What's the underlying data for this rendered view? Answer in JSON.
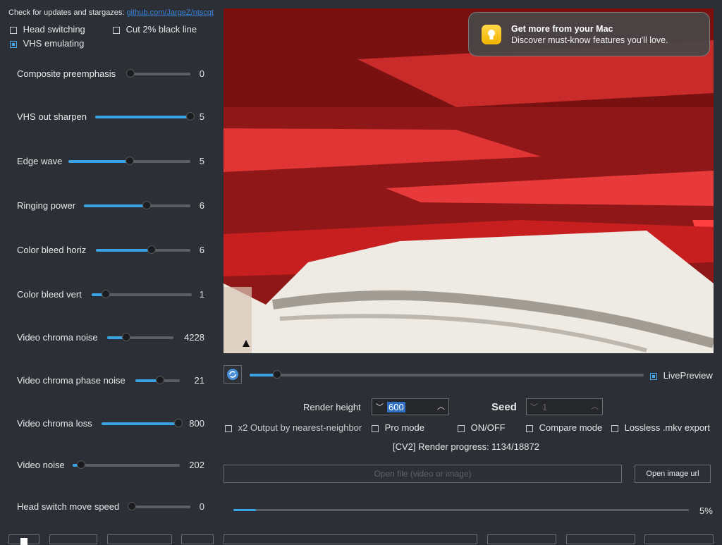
{
  "header": {
    "check_text": "Check for updates and stargazes:",
    "link_text": "github.com/JargeZ/ntscqt"
  },
  "options_left": {
    "head_switching": "Head switching",
    "cut_black_line": "Cut 2% black line",
    "vhs_emulating": "VHS emulating"
  },
  "sliders": [
    {
      "label": "Composite preemphasis",
      "value": "0",
      "fraction": 0.0
    },
    {
      "label": "VHS out sharpen",
      "value": "5",
      "fraction": 1.0
    },
    {
      "label": "Edge wave",
      "value": "5",
      "fraction": 0.5
    },
    {
      "label": "Ringing power",
      "value": "6",
      "fraction": 0.59
    },
    {
      "label": "Color bleed horiz",
      "value": "6",
      "fraction": 0.59
    },
    {
      "label": "Color bleed vert",
      "value": "1",
      "fraction": 0.14
    },
    {
      "label": "Video chroma noise",
      "value": "4228",
      "fraction": 0.29
    },
    {
      "label": "Video chroma phase noise",
      "value": "21",
      "fraction": 0.55
    },
    {
      "label": "Video chroma loss",
      "value": "800",
      "fraction": 0.97
    },
    {
      "label": "Video noise",
      "value": "202",
      "fraction": 0.08
    },
    {
      "label": "Head switch move speed",
      "value": "0",
      "fraction": 0.0
    }
  ],
  "notification": {
    "title": "Get more from your Mac",
    "body": "Discover must-know features you'll love."
  },
  "timeline": {
    "position": 0.07,
    "live_preview": "LivePreview"
  },
  "render": {
    "height_label": "Render height",
    "height_value": "600",
    "seed_label": "Seed",
    "seed_value": "1"
  },
  "options_bottom": {
    "x2_output": "x2 Output by nearest-neighbor",
    "pro_mode": "Pro mode",
    "on_off": "ON/OFF",
    "compare_mode": "Compare mode",
    "lossless": "Lossless .mkv export"
  },
  "status": {
    "render_progress": "[CV2] Render progress: 1134/18872"
  },
  "file": {
    "open_file": "Open file (video or image)",
    "open_url": "Open image url"
  },
  "progress": {
    "percent": "5%",
    "fraction": 0.05
  },
  "colors": {
    "accent": "#3aa3e3",
    "background": "#2c2f35"
  }
}
